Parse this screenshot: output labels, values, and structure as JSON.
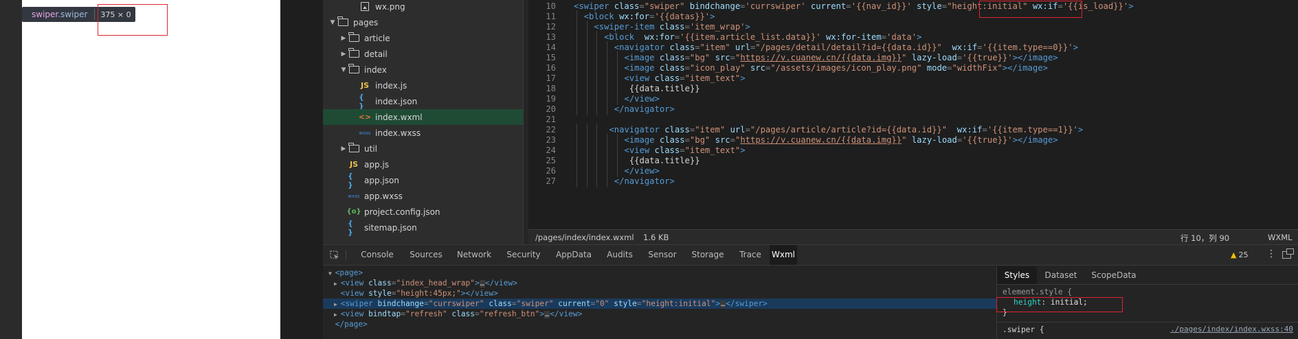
{
  "simulator": {
    "tooltip": {
      "tag": "swiper",
      "class": ".swiper",
      "size": "375 × 0"
    }
  },
  "file_tree": [
    {
      "name": "wx.png",
      "type": "png",
      "level": 2,
      "arrow": ""
    },
    {
      "name": "pages",
      "type": "folder",
      "level": 0,
      "arrow": "down"
    },
    {
      "name": "article",
      "type": "folder",
      "level": 1,
      "arrow": "right"
    },
    {
      "name": "detail",
      "type": "folder",
      "level": 1,
      "arrow": "right"
    },
    {
      "name": "index",
      "type": "folder",
      "level": 1,
      "arrow": "down"
    },
    {
      "name": "index.js",
      "type": "js",
      "level": 2,
      "arrow": ""
    },
    {
      "name": "index.json",
      "type": "json",
      "level": 2,
      "arrow": ""
    },
    {
      "name": "index.wxml",
      "type": "wxml",
      "level": 2,
      "arrow": "",
      "selected": true
    },
    {
      "name": "index.wxss",
      "type": "wxss",
      "level": 2,
      "arrow": ""
    },
    {
      "name": "util",
      "type": "folder",
      "level": 1,
      "arrow": "right"
    },
    {
      "name": "app.js",
      "type": "js",
      "level": 1,
      "arrow": ""
    },
    {
      "name": "app.json",
      "type": "json",
      "level": 1,
      "arrow": ""
    },
    {
      "name": "app.wxss",
      "type": "wxss",
      "level": 1,
      "arrow": ""
    },
    {
      "name": "project.config.json",
      "type": "cfg",
      "level": 1,
      "arrow": ""
    },
    {
      "name": "sitemap.json",
      "type": "json",
      "level": 1,
      "arrow": ""
    }
  ],
  "icons": {
    "js": "JS",
    "json": "{ }",
    "wxml": "<>",
    "wxss": "wxss",
    "cfg": "{o}"
  },
  "editor": {
    "lines": [
      {
        "no": "10",
        "indent": 0,
        "tokens": [
          [
            "tag",
            "<swiper "
          ],
          [
            "attr",
            "class"
          ],
          [
            "punc",
            "="
          ],
          [
            "str",
            "\"swiper\""
          ],
          [
            "txt",
            " "
          ],
          [
            "attr",
            "bindchange"
          ],
          [
            "punc",
            "="
          ],
          [
            "str",
            "'currswiper'"
          ],
          [
            "txt",
            " "
          ],
          [
            "attr",
            "current"
          ],
          [
            "punc",
            "="
          ],
          [
            "str",
            "'{{nav_id}}'"
          ],
          [
            "txt",
            " "
          ],
          [
            "attr",
            "style"
          ],
          [
            "punc",
            "="
          ],
          [
            "str",
            "\"height:initial\""
          ],
          [
            "txt",
            " "
          ],
          [
            "attr",
            "wx:if"
          ],
          [
            "punc",
            "="
          ],
          [
            "str",
            "'{{is_load}}'"
          ],
          [
            "tag",
            ">"
          ]
        ]
      },
      {
        "no": "11",
        "indent": 1,
        "tokens": [
          [
            "tag",
            "<block "
          ],
          [
            "attr",
            "wx:for"
          ],
          [
            "punc",
            "="
          ],
          [
            "str",
            "'{{datas}}'"
          ],
          [
            "tag",
            ">"
          ]
        ]
      },
      {
        "no": "12",
        "indent": 2,
        "tokens": [
          [
            "tag",
            "<swiper-item "
          ],
          [
            "attr",
            "class"
          ],
          [
            "punc",
            "="
          ],
          [
            "str",
            "'item_wrap'"
          ],
          [
            "tag",
            ">"
          ]
        ]
      },
      {
        "no": "13",
        "indent": 3,
        "tokens": [
          [
            "tag",
            "<block  "
          ],
          [
            "attr",
            "wx:for"
          ],
          [
            "punc",
            "="
          ],
          [
            "str",
            "'{{item.article_list.data}}'"
          ],
          [
            "txt",
            " "
          ],
          [
            "attr",
            "wx:for-item"
          ],
          [
            "punc",
            "="
          ],
          [
            "str",
            "'data'"
          ],
          [
            "tag",
            ">"
          ]
        ]
      },
      {
        "no": "14",
        "indent": 4,
        "tokens": [
          [
            "tag",
            "<navigator "
          ],
          [
            "attr",
            "class"
          ],
          [
            "punc",
            "="
          ],
          [
            "str",
            "\"item\""
          ],
          [
            "txt",
            " "
          ],
          [
            "attr",
            "url"
          ],
          [
            "punc",
            "="
          ],
          [
            "str",
            "\"/pages/detail/detail?id={{data.id}}\""
          ],
          [
            "txt",
            "  "
          ],
          [
            "attr",
            "wx:if"
          ],
          [
            "punc",
            "="
          ],
          [
            "str",
            "'{{item.type==0}}'"
          ],
          [
            "tag",
            ">"
          ]
        ]
      },
      {
        "no": "15",
        "indent": 5,
        "tokens": [
          [
            "tag",
            "<image "
          ],
          [
            "attr",
            "class"
          ],
          [
            "punc",
            "="
          ],
          [
            "str",
            "\"bg\""
          ],
          [
            "txt",
            " "
          ],
          [
            "attr",
            "src"
          ],
          [
            "punc",
            "="
          ],
          [
            "str",
            "\""
          ],
          [
            "url",
            "https://v.cuanew.cn/{{data.img}}"
          ],
          [
            "str",
            "\""
          ],
          [
            "txt",
            " "
          ],
          [
            "attr",
            "lazy-load"
          ],
          [
            "punc",
            "="
          ],
          [
            "str",
            "'{{true}}'"
          ],
          [
            "tag",
            "></image>"
          ]
        ]
      },
      {
        "no": "16",
        "indent": 5,
        "tokens": [
          [
            "tag",
            "<image "
          ],
          [
            "attr",
            "class"
          ],
          [
            "punc",
            "="
          ],
          [
            "str",
            "\"icon_play\""
          ],
          [
            "txt",
            " "
          ],
          [
            "attr",
            "src"
          ],
          [
            "punc",
            "="
          ],
          [
            "str",
            "\"/assets/images/icon_play.png\""
          ],
          [
            "txt",
            " "
          ],
          [
            "attr",
            "mode"
          ],
          [
            "punc",
            "="
          ],
          [
            "str",
            "\"widthFix\""
          ],
          [
            "tag",
            "></image>"
          ]
        ]
      },
      {
        "no": "17",
        "indent": 5,
        "tokens": [
          [
            "tag",
            "<view "
          ],
          [
            "attr",
            "class"
          ],
          [
            "punc",
            "="
          ],
          [
            "str",
            "\"item_text\""
          ],
          [
            "tag",
            ">"
          ]
        ]
      },
      {
        "no": "18",
        "indent": 5,
        "tokens": [
          [
            "txt",
            " {{data.title}}"
          ]
        ]
      },
      {
        "no": "19",
        "indent": 5,
        "tokens": [
          [
            "tag",
            "</view>"
          ]
        ]
      },
      {
        "no": "20",
        "indent": 4,
        "tokens": [
          [
            "tag",
            "</navigator>"
          ]
        ]
      },
      {
        "no": "21",
        "indent": 0,
        "tokens": []
      },
      {
        "no": "22",
        "indent": 3,
        "tokens": [
          [
            "txt",
            " "
          ],
          [
            "tag",
            "<navigator "
          ],
          [
            "attr",
            "class"
          ],
          [
            "punc",
            "="
          ],
          [
            "str",
            "\"item\""
          ],
          [
            "txt",
            " "
          ],
          [
            "attr",
            "url"
          ],
          [
            "punc",
            "="
          ],
          [
            "str",
            "\"/pages/article/article?id={{data.id}}\""
          ],
          [
            "txt",
            "  "
          ],
          [
            "attr",
            "wx:if"
          ],
          [
            "punc",
            "="
          ],
          [
            "str",
            "'{{item.type==1}}'"
          ],
          [
            "tag",
            ">"
          ]
        ]
      },
      {
        "no": "23",
        "indent": 5,
        "tokens": [
          [
            "tag",
            "<image "
          ],
          [
            "attr",
            "class"
          ],
          [
            "punc",
            "="
          ],
          [
            "str",
            "\"bg\""
          ],
          [
            "txt",
            " "
          ],
          [
            "attr",
            "src"
          ],
          [
            "punc",
            "="
          ],
          [
            "str",
            "\""
          ],
          [
            "url",
            "https://v.cuanew.cn/{{data.img}}"
          ],
          [
            "str",
            "\""
          ],
          [
            "txt",
            " "
          ],
          [
            "attr",
            "lazy-load"
          ],
          [
            "punc",
            "="
          ],
          [
            "str",
            "'{{true}}'"
          ],
          [
            "tag",
            "></image>"
          ]
        ]
      },
      {
        "no": "24",
        "indent": 5,
        "tokens": [
          [
            "tag",
            "<view "
          ],
          [
            "attr",
            "class"
          ],
          [
            "punc",
            "="
          ],
          [
            "str",
            "\"item_text\""
          ],
          [
            "tag",
            ">"
          ]
        ]
      },
      {
        "no": "25",
        "indent": 5,
        "tokens": [
          [
            "txt",
            " {{data.title}}"
          ]
        ]
      },
      {
        "no": "26",
        "indent": 5,
        "tokens": [
          [
            "tag",
            "</view>"
          ]
        ]
      },
      {
        "no": "27",
        "indent": 4,
        "tokens": [
          [
            "tag",
            "</navigator>"
          ]
        ]
      }
    ]
  },
  "status_bar": {
    "path": "/pages/index/index.wxml",
    "size": "1.6 KB",
    "position": "行 10，列 90",
    "language": "WXML"
  },
  "devtools": {
    "tabs": [
      "Console",
      "Sources",
      "Network",
      "Security",
      "AppData",
      "Audits",
      "Sensor",
      "Storage",
      "Trace",
      "Wxml"
    ],
    "active_tab": "Wxml",
    "warnings": "25",
    "wxml_rows": [
      {
        "tri": "▼",
        "indent": 0,
        "tokens": [
          [
            "tag",
            "<page>"
          ]
        ]
      },
      {
        "tri": "▶",
        "indent": 1,
        "tokens": [
          [
            "tag",
            "<view "
          ],
          [
            "attr",
            "class"
          ],
          [
            "punc",
            "="
          ],
          [
            "str",
            "\"index_head_wrap\""
          ],
          [
            "tag",
            ">"
          ],
          [
            "ell",
            "…"
          ],
          [
            "tag",
            "</view>"
          ]
        ]
      },
      {
        "tri": "",
        "indent": 1,
        "tokens": [
          [
            "tag",
            "<view "
          ],
          [
            "attr",
            "style"
          ],
          [
            "punc",
            "="
          ],
          [
            "str",
            "\"height:45px;\""
          ],
          [
            "tag",
            "></view>"
          ]
        ]
      },
      {
        "tri": "▶",
        "indent": 1,
        "sel": true,
        "tokens": [
          [
            "tag",
            "<swiper "
          ],
          [
            "attr",
            "bindchange"
          ],
          [
            "punc",
            "="
          ],
          [
            "str",
            "\"currswiper\""
          ],
          [
            "txt",
            " "
          ],
          [
            "attr",
            "class"
          ],
          [
            "punc",
            "="
          ],
          [
            "str",
            "\"swiper\""
          ],
          [
            "txt",
            " "
          ],
          [
            "attr",
            "current"
          ],
          [
            "punc",
            "="
          ],
          [
            "str",
            "\"0\""
          ],
          [
            "txt",
            " "
          ],
          [
            "attr",
            "style"
          ],
          [
            "punc",
            "="
          ],
          [
            "str",
            "\"height:initial\""
          ],
          [
            "tag",
            ">"
          ],
          [
            "ell",
            "…"
          ],
          [
            "tag",
            "</swiper>"
          ]
        ]
      },
      {
        "tri": "▶",
        "indent": 1,
        "tokens": [
          [
            "tag",
            "<view "
          ],
          [
            "attr",
            "bindtap"
          ],
          [
            "punc",
            "="
          ],
          [
            "str",
            "\"refresh\""
          ],
          [
            "txt",
            " "
          ],
          [
            "attr",
            "class"
          ],
          [
            "punc",
            "="
          ],
          [
            "str",
            "\"refresh_btn\""
          ],
          [
            "tag",
            ">"
          ],
          [
            "ell",
            "…"
          ],
          [
            "tag",
            "</view>"
          ]
        ]
      },
      {
        "tri": "",
        "indent": 0,
        "tokens": [
          [
            "tag",
            "</page>"
          ]
        ]
      }
    ],
    "styles_tabs": [
      "Styles",
      "Dataset",
      "ScopeData"
    ],
    "styles_active": "Styles",
    "styles": {
      "element_style_open": "element.style {",
      "prop": "height",
      "value": "initial;",
      "close": "}",
      "rule_selector": ".swiper {",
      "rule_source": "./pages/index/index.wxss:40"
    }
  }
}
